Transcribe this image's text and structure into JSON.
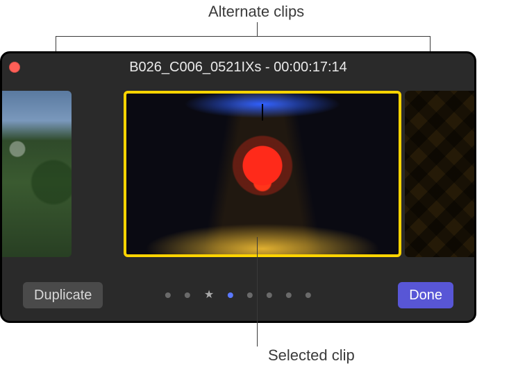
{
  "annotations": {
    "alternate_clips": "Alternate clips",
    "selected_clip": "Selected clip"
  },
  "window": {
    "title": "B026_C006_0521IXs - 00:00:17:14"
  },
  "clips": {
    "left_alt_name": "alternate-clip-left",
    "center_name": "selected-clip",
    "right_alt_name": "alternate-clip-right"
  },
  "footer": {
    "duplicate_label": "Duplicate",
    "done_label": "Done"
  },
  "indicators": {
    "count": 8,
    "star_index": 2,
    "active_index": 3
  }
}
